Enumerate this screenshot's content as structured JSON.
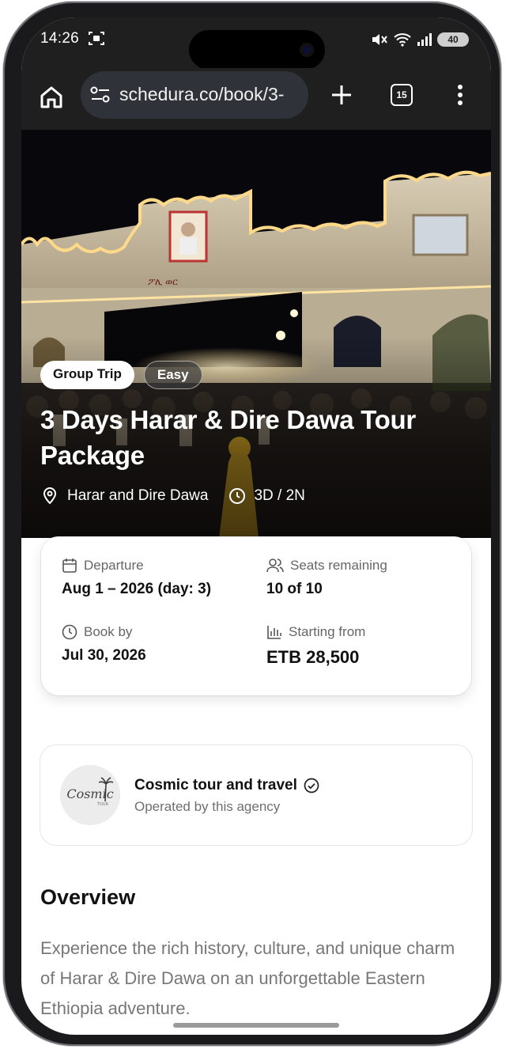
{
  "status_bar": {
    "time": "14:26",
    "battery": "40"
  },
  "browser": {
    "url": "schedura.co/book/3-",
    "tab_count": "15"
  },
  "trip": {
    "badges": [
      "Group Trip",
      "Easy"
    ],
    "title": "3 Days Harar & Dire Dawa Tour Package",
    "location": "Harar and Dire Dawa",
    "duration": "3D / 2N",
    "hero_sign": "ፖሊ    ወር"
  },
  "details": {
    "departure_label": "Departure",
    "departure_value": "Aug 1 – 2026 (day: 3)",
    "seats_label": "Seats remaining",
    "seats_value": "10 of 10",
    "bookby_label": "Book by",
    "bookby_value": "Jul 30, 2026",
    "price_label": "Starting from",
    "price_value": "ETB 28,500"
  },
  "agency": {
    "name": "Cosmic tour and travel",
    "subtitle": "Operated by this agency",
    "logo_text": "Cosmic",
    "logo_small": "TOUR"
  },
  "overview": {
    "title": "Overview",
    "text": "Experience the rich history, culture, and unique charm of Harar & Dire Dawa on an unforgettable Eastern Ethiopia adventure."
  },
  "colors": {
    "browser_bg": "#1f1f1f",
    "url_pill": "#2f3339",
    "gate_glow": "#ffd98a"
  },
  "icons": [
    "home-icon",
    "tune-icon",
    "plus-icon",
    "tabs-icon",
    "more-vert-icon",
    "location-pin-icon",
    "clock-icon",
    "calendar-icon",
    "users-icon",
    "bar-chart-icon",
    "verified-icon"
  ]
}
